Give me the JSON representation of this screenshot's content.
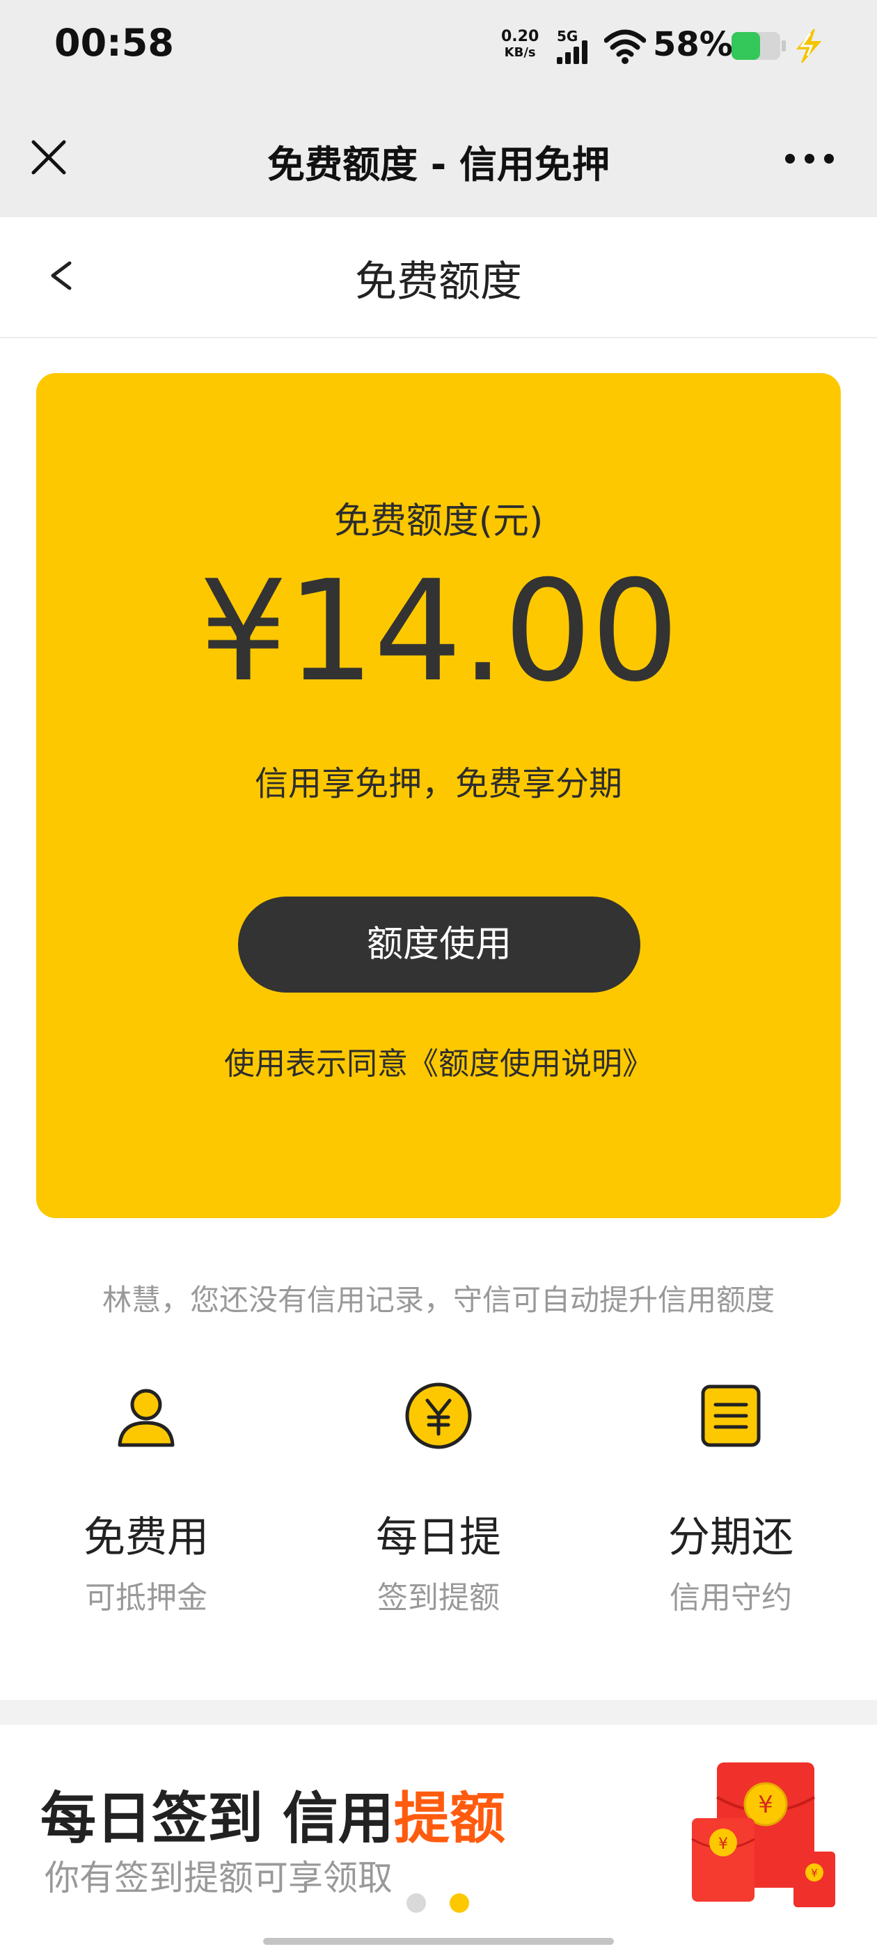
{
  "status_bar": {
    "time": "00:58",
    "net_speed_value": "0.20",
    "net_speed_unit": "KB/s",
    "network": "5G",
    "battery_percent": "58%",
    "battery_level": 0.58,
    "battery_color": "#34c759"
  },
  "title_bar": {
    "title": "免费额度 - 信用免押"
  },
  "page_header": {
    "title": "免费额度"
  },
  "quota_card": {
    "label": "免费额度(元)",
    "amount": "¥14.00",
    "slogan": "信用享免押，免费享分期",
    "button_label": "额度使用",
    "agreement_text": "使用表示同意《额度使用说明》",
    "background_color": "#fdc800"
  },
  "credit_tip": "林慧，您还没有信用记录，守信可自动提升信用额度",
  "features": [
    {
      "icon": "user-icon",
      "title": "免费用",
      "subtitle": "可抵押金"
    },
    {
      "icon": "yen-coin-icon",
      "title": "每日提",
      "subtitle": "签到提额"
    },
    {
      "icon": "list-icon",
      "title": "分期还",
      "subtitle": "信用守约"
    }
  ],
  "banner": {
    "title_part1": "每日签到 信用",
    "title_highlight": "提额",
    "subtitle": "你有签到提额可享领取",
    "highlight_color": "#ff5b0f",
    "image_icon": "red-envelope-icon"
  },
  "carousel": {
    "page_count": 2,
    "active_index": 1
  }
}
